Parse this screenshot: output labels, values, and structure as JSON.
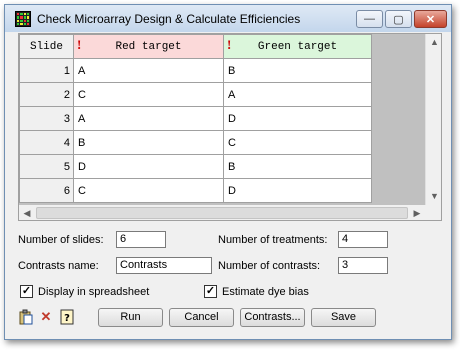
{
  "window": {
    "title": "Check Microarray Design & Calculate Efficiencies",
    "controls": {
      "minimize": "—",
      "maximize": "▢",
      "close": "✕"
    }
  },
  "grid": {
    "headers": {
      "slide": "Slide",
      "red": "Red target",
      "green": "Green target",
      "required_marker": "!"
    },
    "rows": [
      {
        "slide": "1",
        "red": "A",
        "green": "B"
      },
      {
        "slide": "2",
        "red": "C",
        "green": "A"
      },
      {
        "slide": "3",
        "red": "A",
        "green": "D"
      },
      {
        "slide": "4",
        "red": "B",
        "green": "C"
      },
      {
        "slide": "5",
        "red": "D",
        "green": "B"
      },
      {
        "slide": "6",
        "red": "C",
        "green": "D"
      }
    ],
    "scroll_up": "▲",
    "scroll_down": "▼",
    "scroll_left": "◀",
    "scroll_right": "▶"
  },
  "form": {
    "num_slides_label": "Number of slides:",
    "num_slides_value": "6",
    "num_treatments_label": "Number of treatments:",
    "num_treatments_value": "4",
    "contrasts_name_label": "Contrasts name:",
    "contrasts_name_value": "Contrasts",
    "num_contrasts_label": "Number of contrasts:",
    "num_contrasts_value": "3",
    "display_spreadsheet_label": "Display in spreadsheet",
    "display_spreadsheet_checked": true,
    "estimate_dye_bias_label": "Estimate dye bias",
    "estimate_dye_bias_checked": true
  },
  "toolbar": {
    "run_label": "Run",
    "cancel_label": "Cancel",
    "contrasts_label": "Contrasts...",
    "save_label": "Save",
    "check_mark": "✓"
  },
  "colors": {
    "red_header": "#fbd9d9",
    "green_header": "#dbf6db",
    "required_marker": "#cc0000"
  },
  "icons": [
    "spreadsheet-app-icon",
    "paste-icon",
    "clear-icon",
    "help-icon"
  ]
}
